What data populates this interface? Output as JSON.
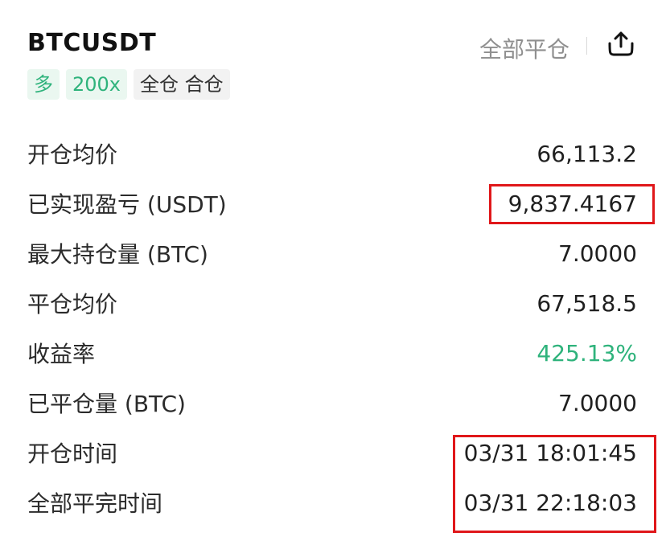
{
  "header": {
    "symbol": "BTCUSDT",
    "close_all_label": "全部平仓",
    "share_icon": "share-icon"
  },
  "tags": [
    {
      "label": "多",
      "color": "#2fb37c"
    },
    {
      "label": "200x",
      "color": "#2fb37c"
    },
    {
      "label": "全仓 合仓",
      "color": "#333333"
    }
  ],
  "rows": [
    {
      "label": "开仓均价",
      "value": "66,113.2"
    },
    {
      "label": "已实现盈亏 (USDT)",
      "value": "9,837.4167"
    },
    {
      "label": "最大持仓量 (BTC)",
      "value": "7.0000"
    },
    {
      "label": "平仓均价",
      "value": "67,518.5"
    },
    {
      "label": "收益率",
      "value": "425.13%"
    },
    {
      "label": "已平仓量 (BTC)",
      "value": "7.0000"
    },
    {
      "label": "开仓时间",
      "value": "03/31 18:01:45"
    },
    {
      "label": "全部平完时间",
      "value": "03/31 22:18:03"
    }
  ],
  "colors": {
    "positive": "#2fb37c",
    "highlight_box": "#e0171a"
  }
}
